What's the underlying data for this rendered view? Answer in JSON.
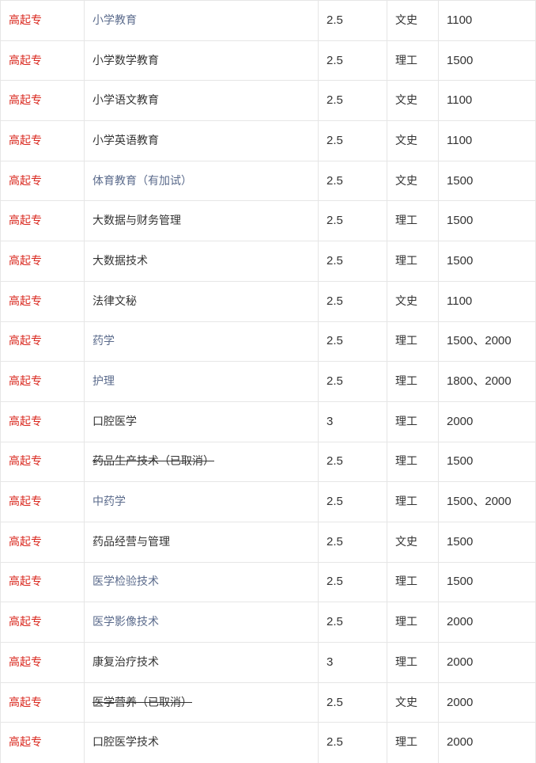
{
  "rows": [
    {
      "level": "高起专",
      "major": "小学教育",
      "major_style": "link",
      "years": "2.5",
      "category": "文史",
      "fee": "1100"
    },
    {
      "level": "高起专",
      "major": "小学数学教育",
      "major_style": "plain",
      "years": "2.5",
      "category": "理工",
      "fee": "1500"
    },
    {
      "level": "高起专",
      "major": "小学语文教育",
      "major_style": "plain",
      "years": "2.5",
      "category": "文史",
      "fee": "1100"
    },
    {
      "level": "高起专",
      "major": "小学英语教育",
      "major_style": "plain",
      "years": "2.5",
      "category": "文史",
      "fee": "1100"
    },
    {
      "level": "高起专",
      "major": "体育教育（有加试）",
      "major_style": "link",
      "years": "2.5",
      "category": "文史",
      "fee": "1500"
    },
    {
      "level": "高起专",
      "major": "大数据与财务管理",
      "major_style": "plain",
      "years": "2.5",
      "category": "理工",
      "fee": "1500"
    },
    {
      "level": "高起专",
      "major": "大数据技术",
      "major_style": "plain",
      "years": "2.5",
      "category": "理工",
      "fee": "1500"
    },
    {
      "level": "高起专",
      "major": "法律文秘",
      "major_style": "plain",
      "years": "2.5",
      "category": "文史",
      "fee": "1100"
    },
    {
      "level": "高起专",
      "major": "药学",
      "major_style": "link",
      "years": "2.5",
      "category": "理工",
      "fee": "1500、2000"
    },
    {
      "level": "高起专",
      "major": "护理",
      "major_style": "link",
      "years": "2.5",
      "category": "理工",
      "fee": "1800、2000"
    },
    {
      "level": "高起专",
      "major": "口腔医学",
      "major_style": "plain",
      "years": "3",
      "category": "理工",
      "fee": "2000"
    },
    {
      "level": "高起专",
      "major": "药品生产技术（已取消）",
      "major_style": "struck",
      "years": "2.5",
      "category": "理工",
      "fee": "1500"
    },
    {
      "level": "高起专",
      "major": "中药学",
      "major_style": "link",
      "years": "2.5",
      "category": "理工",
      "fee": "1500、2000"
    },
    {
      "level": "高起专",
      "major": "药品经营与管理",
      "major_style": "plain",
      "years": "2.5",
      "category": "文史",
      "fee": "1500"
    },
    {
      "level": "高起专",
      "major": "医学检验技术",
      "major_style": "link",
      "years": "2.5",
      "category": "理工",
      "fee": "1500"
    },
    {
      "level": "高起专",
      "major": "医学影像技术",
      "major_style": "link",
      "years": "2.5",
      "category": "理工",
      "fee": "2000"
    },
    {
      "level": "高起专",
      "major": "康复治疗技术",
      "major_style": "plain",
      "years": "3",
      "category": "理工",
      "fee": "2000"
    },
    {
      "level": "高起专",
      "major": "医学营养（已取消）",
      "major_style": "struck",
      "years": "2.5",
      "category": "文史",
      "fee": "2000"
    },
    {
      "level": "高起专",
      "major": "口腔医学技术",
      "major_style": "plain",
      "years": "2.5",
      "category": "理工",
      "fee": "2000"
    }
  ],
  "colors": {
    "level_text": "#d9261c",
    "link_text": "#5b6b8c",
    "body_text": "#333333",
    "border": "#e6e6e6"
  }
}
